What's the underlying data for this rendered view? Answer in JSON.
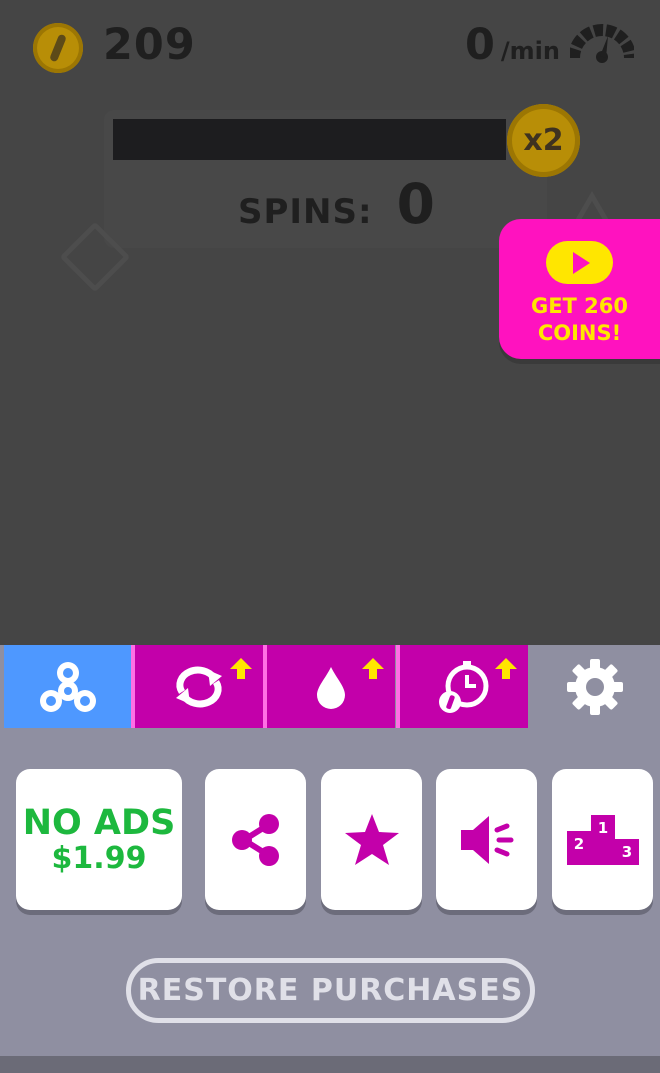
{
  "hud": {
    "coins": "209",
    "rate_value": "0",
    "rate_unit": "/min",
    "multiplier": "x2",
    "spins_label": "SPINS:",
    "spins_value": "0"
  },
  "reward_button": {
    "line1": "GET 260",
    "line2": "COINS!"
  },
  "tabs": [
    {
      "icon": "fidget-spinner-icon",
      "active": true
    },
    {
      "icon": "spin-arrows-icon",
      "upgrade": true
    },
    {
      "icon": "drop-icon",
      "upgrade": true
    },
    {
      "icon": "stopwatch-icon",
      "upgrade": true
    },
    {
      "icon": "gear-icon"
    }
  ],
  "menu": {
    "no_ads_label": "NO ADS",
    "no_ads_price": "$1.99",
    "podium_labels": [
      "1",
      "2",
      "3"
    ],
    "restore_label": "RESTORE PURCHASES"
  },
  "colors": {
    "magenta": "#c300aa",
    "pink": "#ff12bf",
    "yellow": "#ffe600",
    "blue": "#4e98ff",
    "green": "#1db83e",
    "menu_bg": "#8f8fa1",
    "overlay_bg": "#454545"
  }
}
